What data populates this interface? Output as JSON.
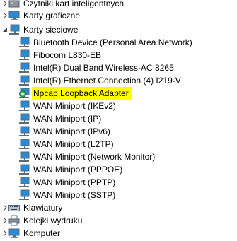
{
  "tree": {
    "top_partial": {
      "label": "Czytniki kart inteligentnych",
      "icon": "smartcard-icon"
    },
    "categories": [
      {
        "label": "Karty graficzne",
        "icon": "display-adapter-icon",
        "expanded": false
      },
      {
        "label": "Karty sieciowe",
        "icon": "network-adapter-icon",
        "expanded": true,
        "children": [
          {
            "label": "Bluetooth Device (Personal Area Network)",
            "icon": "network-adapter-icon"
          },
          {
            "label": "Fibocom L830-EB",
            "icon": "network-adapter-icon"
          },
          {
            "label": "Intel(R) Dual Band Wireless-AC 8265",
            "icon": "network-adapter-icon"
          },
          {
            "label": "Intel(R) Ethernet Connection (4) I219-V",
            "icon": "network-adapter-icon"
          },
          {
            "label": "Npcap Loopback Adapter",
            "icon": "network-adapter-warning-icon",
            "highlighted": true,
            "highlight_color": "#ffff00"
          },
          {
            "label": "WAN Miniport (IKEv2)",
            "icon": "network-adapter-icon"
          },
          {
            "label": "WAN Miniport (IP)",
            "icon": "network-adapter-icon"
          },
          {
            "label": "WAN Miniport (IPv6)",
            "icon": "network-adapter-icon"
          },
          {
            "label": "WAN Miniport (L2TP)",
            "icon": "network-adapter-icon"
          },
          {
            "label": "WAN Miniport (Network Monitor)",
            "icon": "network-adapter-icon"
          },
          {
            "label": "WAN Miniport (PPPOE)",
            "icon": "network-adapter-icon"
          },
          {
            "label": "WAN Miniport (PPTP)",
            "icon": "network-adapter-icon"
          },
          {
            "label": "WAN Miniport (SSTP)",
            "icon": "network-adapter-icon"
          }
        ]
      },
      {
        "label": "Klawiatury",
        "icon": "keyboard-icon",
        "expanded": false
      },
      {
        "label": "Kolejki wydruku",
        "icon": "printer-icon",
        "expanded": false
      },
      {
        "label": "Komputer",
        "icon": "computer-icon",
        "expanded": false
      }
    ]
  },
  "colors": {
    "highlight": "#ffff00",
    "monitor_screen": "#2a8ad4",
    "icon_frame": "#5a6b7a"
  }
}
